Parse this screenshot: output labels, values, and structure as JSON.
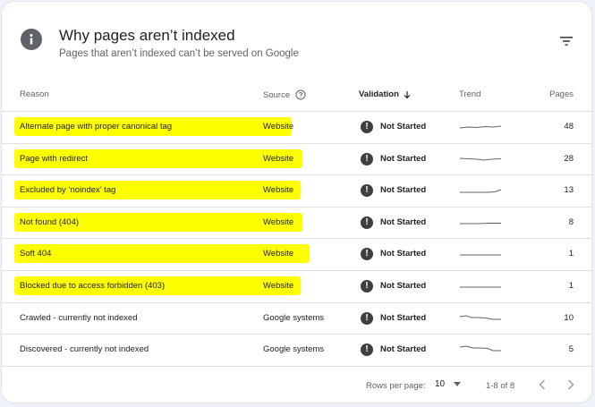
{
  "header": {
    "title": "Why pages aren’t indexed",
    "subtitle": "Pages that aren’t indexed can’t be served on Google"
  },
  "columns": {
    "reason": "Reason",
    "source": "Source",
    "validation": "Validation",
    "trend": "Trend",
    "pages": "Pages"
  },
  "rows": [
    {
      "reason": "Alternate page with proper canonical tag",
      "source": "Website",
      "validation": "Not Started",
      "pages": "48",
      "highlighted": true
    },
    {
      "reason": "Page with redirect",
      "source": "Website",
      "validation": "Not Started",
      "pages": "28",
      "highlighted": true
    },
    {
      "reason": "Excluded by ‘noindex’ tag",
      "source": "Website",
      "validation": "Not Started",
      "pages": "13",
      "highlighted": true
    },
    {
      "reason": "Not found (404)",
      "source": "Website",
      "validation": "Not Started",
      "pages": "8",
      "highlighted": true
    },
    {
      "reason": "Soft 404",
      "source": "Website",
      "validation": "Not Started",
      "pages": "1",
      "highlighted": true
    },
    {
      "reason": "Blocked due to access forbidden (403)",
      "source": "Website",
      "validation": "Not Started",
      "pages": "1",
      "highlighted": true
    },
    {
      "reason": "Crawled - currently not indexed",
      "source": "Google systems",
      "validation": "Not Started",
      "pages": "10",
      "highlighted": false
    },
    {
      "reason": "Discovered - currently not indexed",
      "source": "Google systems",
      "validation": "Not Started",
      "pages": "5",
      "highlighted": false
    }
  ],
  "footer": {
    "rows_per_page_label": "Rows per page:",
    "rows_per_page_value": "10",
    "range": "1-8 of 8"
  },
  "colors": {
    "highlight": "#ffff00",
    "status_icon": "#3c4043",
    "sparkline": "#5f6368"
  }
}
